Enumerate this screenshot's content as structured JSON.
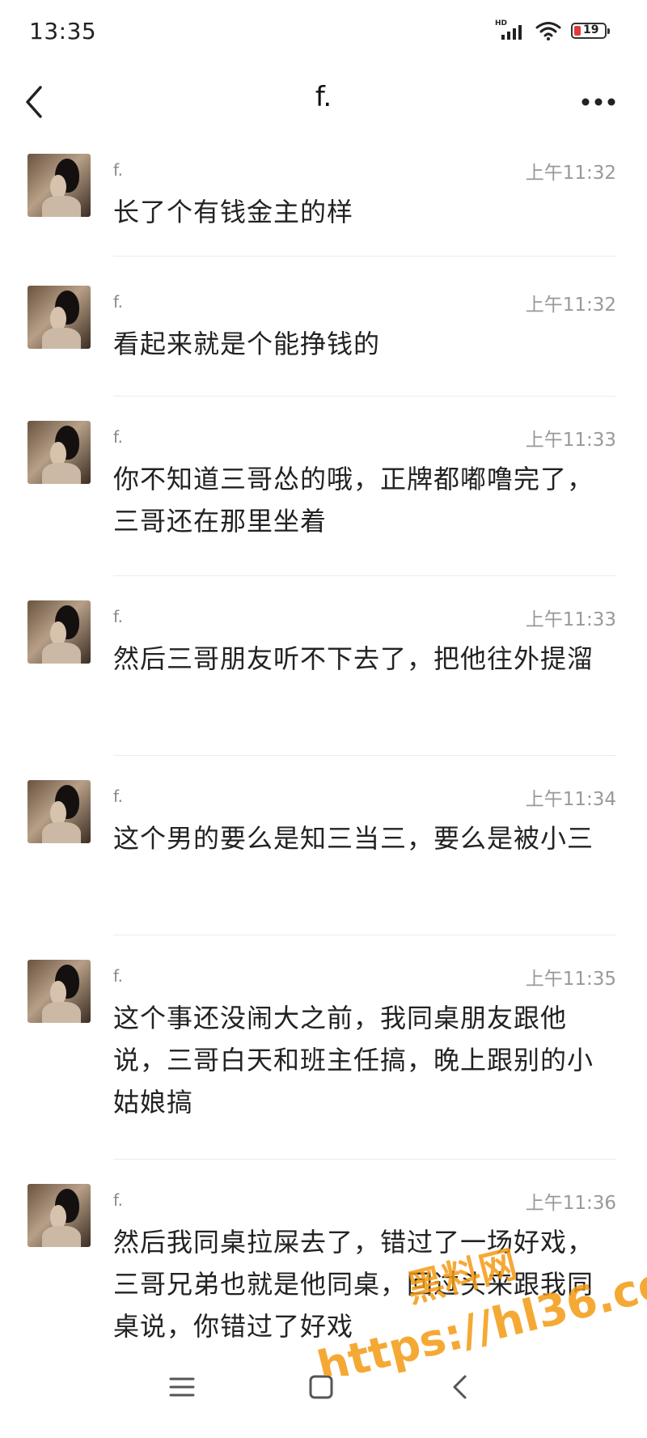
{
  "status_bar": {
    "time": "13:35",
    "signal_label": "HD",
    "battery_level": "19",
    "battery_color": "#e23a3a"
  },
  "header": {
    "title": "f.",
    "back_icon": "chevron-left-icon",
    "more_icon": "more-horizontal-icon"
  },
  "messages": [
    {
      "sender": "f.",
      "time": "上午11:32",
      "text": "长了个有钱金主的样"
    },
    {
      "sender": "f.",
      "time": "上午11:32",
      "text": "看起来就是个能挣钱的"
    },
    {
      "sender": "f.",
      "time": "上午11:33",
      "text": "你不知道三哥怂的哦，正牌都嘟噜完了，三哥还在那里坐着"
    },
    {
      "sender": "f.",
      "time": "上午11:33",
      "text": "然后三哥朋友听不下去了，把他往外提溜"
    },
    {
      "sender": "f.",
      "time": "上午11:34",
      "text": "这个男的要么是知三当三，要么是被小三"
    },
    {
      "sender": "f.",
      "time": "上午11:35",
      "text": "这个事还没闹大之前，我同桌朋友跟他说，三哥白天和班主任搞，晚上跟别的小姑娘搞"
    },
    {
      "sender": "f.",
      "time": "上午11:36",
      "text": "然后我同桌拉屎去了，错过了一场好戏，三哥兄弟也就是他同桌，回过头来跟我同桌说，你错过了好戏"
    }
  ],
  "system_nav": {
    "menu_icon": "menu-icon",
    "home_icon": "home-square-icon",
    "back_icon": "back-arrow-icon"
  },
  "watermark": {
    "title": "黑料网",
    "url": "https://hl36.co",
    "color": "#f39a12"
  }
}
